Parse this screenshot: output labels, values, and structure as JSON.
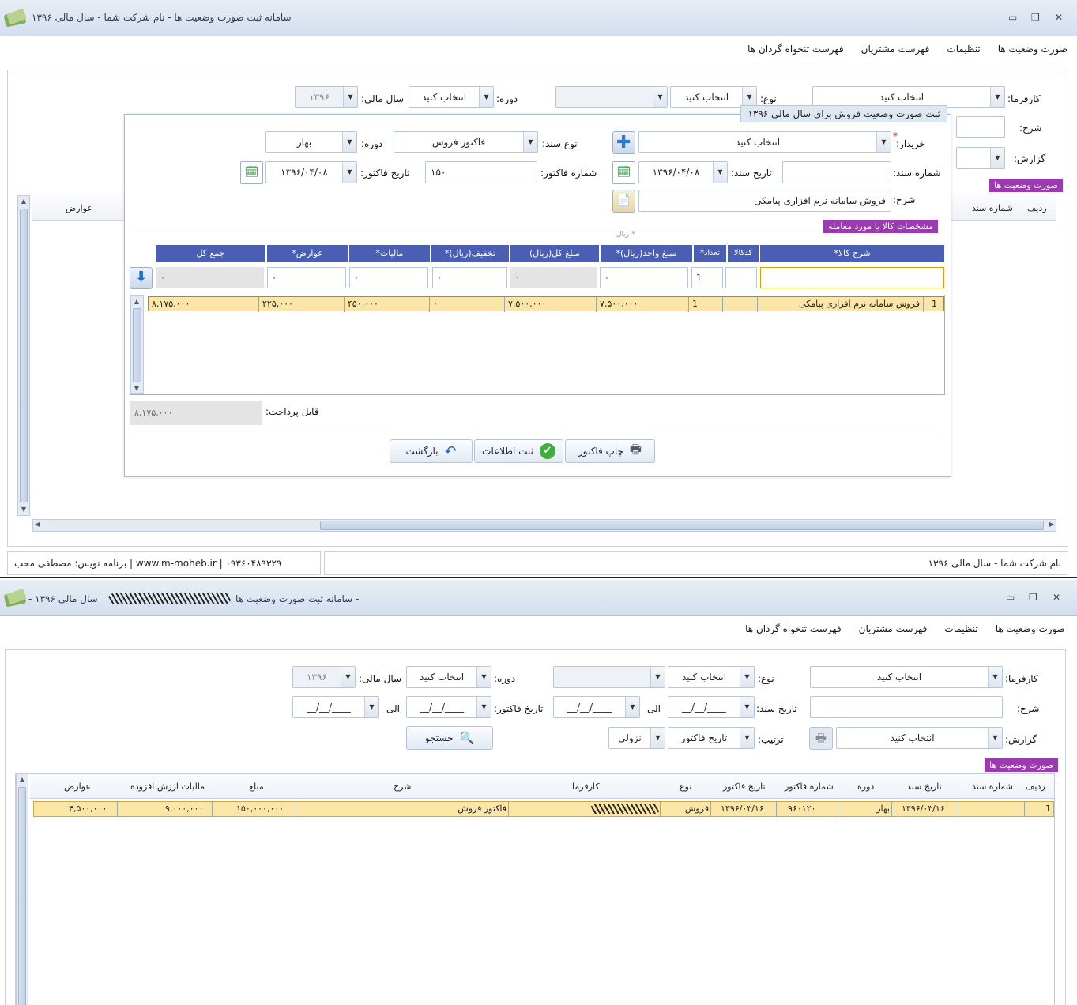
{
  "window1": {
    "title": "سامانه ثبت صورت وضعیت ها - نام شرکت شما - سال مالی ۱۳۹۶",
    "menu": [
      "صورت وضعیت ها",
      "تنظیمات",
      "فهرست مشتریان",
      "فهرست تنخواه گردان ها"
    ],
    "bg_filter": {
      "karfarma_label": "کارفرما:",
      "karfarma_value": "انتخاب کنید",
      "noe_label": "نوع:",
      "noe_value": "انتخاب کنید",
      "dore_label": "دوره:",
      "dore_value": "انتخاب کنید",
      "sal_label": "سال مالی:",
      "sal_value": "۱۳۹۶",
      "sharh_label": "شرح:",
      "gozaresh_label": "گزارش:",
      "tag": "صورت وضعیت ها",
      "col_radif": "ردیف",
      "col_shomare": "شماره سند",
      "col_avarez": "عوارض"
    },
    "dialog": {
      "title": "ثبت صورت وضعیت فروش برای سال مالی ۱۳۹۶",
      "kharidar_label": "خریدار:",
      "kharidar_value": "انتخاب کنید",
      "required_mark": "*",
      "noe_sanad_label": "نوع سند:",
      "noe_sanad_value": "فاکتور فروش",
      "dore_label": "دوره:",
      "dore_value": "بهار",
      "shomare_sanad_label": "شماره سند:",
      "shomare_sanad_value": "",
      "tarikh_sanad_label": "تاریخ سند:",
      "tarikh_sanad_value": "۱۳۹۶/۰۴/۰۸",
      "shomare_factor_label": "شماره فاکتور:",
      "shomare_factor_value": "۱۵۰",
      "tarikh_factor_label": "تاریخ فاکتور:",
      "tarikh_factor_value": "۱۳۹۶/۰۴/۰۸",
      "sharh_label": "شرح:",
      "sharh_value": "فروش سامانه نرم افزاری پیامکی",
      "section_tag": "مشخصات کالا یا مورد معامله",
      "unit_note": "* ریال",
      "columns": [
        "شرح کالا*",
        "کدکالا",
        "تعداد*",
        "مبلغ واحد(ریال)*",
        "مبلغ کل(ریال)",
        "تخفیف(ریال)*",
        "مالیات*",
        "عوارض*",
        "جمع کل"
      ],
      "entry": {
        "sharh": "",
        "kod": "",
        "tedad": "1",
        "mablagh_vahed": "۰",
        "mablagh_kol": "۰",
        "takhfif": "۰",
        "maliat": "۰",
        "avarez": "۰",
        "jam": "۰"
      },
      "rows": [
        [
          "1",
          "فروش سامانه نرم افزاری پیامکی",
          "",
          "1",
          "۷,۵۰۰,۰۰۰",
          "۷,۵۰۰,۰۰۰",
          "۰",
          "۴۵۰,۰۰۰",
          "۲۲۵,۰۰۰",
          "۸,۱۷۵,۰۰۰"
        ]
      ],
      "payable_label": "قابل پرداخت:",
      "payable_value": "۸,۱۷۵,۰۰۰",
      "btn_print": "چاپ فاکتور",
      "btn_save": "ثبت اطلاعات",
      "btn_back": "بازگشت"
    },
    "status_left": "www.m-moheb.ir | ۰۹۳۶۰۴۸۹۳۲۹ | برنامه نویس: مصطفی محب",
    "status_right": "نام شرکت شما - سال مالی ۱۳۹۶"
  },
  "window2": {
    "title_prefix": "سامانه ثبت صورت وضعیت ها -",
    "title_suffix": "- سال مالی ۱۳۹۶",
    "menu": [
      "صورت وضعیت ها",
      "تنظیمات",
      "فهرست مشتریان",
      "فهرست تنخواه گردان ها"
    ],
    "filter": {
      "karfarma_label": "کارفرما:",
      "karfarma_value": "انتخاب کنید",
      "noe_label": "نوع:",
      "noe_value": "انتخاب کنید",
      "dore_label": "دوره:",
      "dore_value": "انتخاب کنید",
      "sal_label": "سال مالی:",
      "sal_value": "۱۳۹۶",
      "sharh_label": "شرح:",
      "tarikh_sanad_label": "تاریخ سند:",
      "tarikh_factor_label": "تاریخ فاکتور:",
      "ela_label": "الی",
      "date_placeholder": "____/__/__",
      "gozaresh_label": "گزارش:",
      "gozaresh_value": "انتخاب کنید",
      "tartib_label": "ترتیب:",
      "tartib_value": "تاریخ فاکتور",
      "sort_dir": "نزولی",
      "search_btn": "جستجو"
    },
    "tag": "صورت وضعیت ها",
    "columns": [
      "ردیف",
      "شماره سند",
      "تاریخ سند",
      "دوره",
      "شماره فاکتور",
      "تاریخ فاکتور",
      "نوع",
      "کارفرما",
      "شرح",
      "مبلغ",
      "مالیات ارزش افزوده",
      "عوارض"
    ],
    "rows": [
      [
        "1",
        "",
        "۱۳۹۶/۰۳/۱۶",
        "بهار",
        "۹۶۰۱۲۰",
        "۱۳۹۶/۰۳/۱۶",
        "فروش",
        "",
        "فاکتور فروش",
        "۱۵۰,۰۰۰,۰۰۰",
        "۹,۰۰۰,۰۰۰",
        "۴,۵۰۰,۰۰۰"
      ]
    ]
  },
  "colors": {
    "accent": "#4a5fb3",
    "tag": "#9b3bb0",
    "selected_row": "#fbe6a8",
    "titlebar": "#d3deee"
  }
}
